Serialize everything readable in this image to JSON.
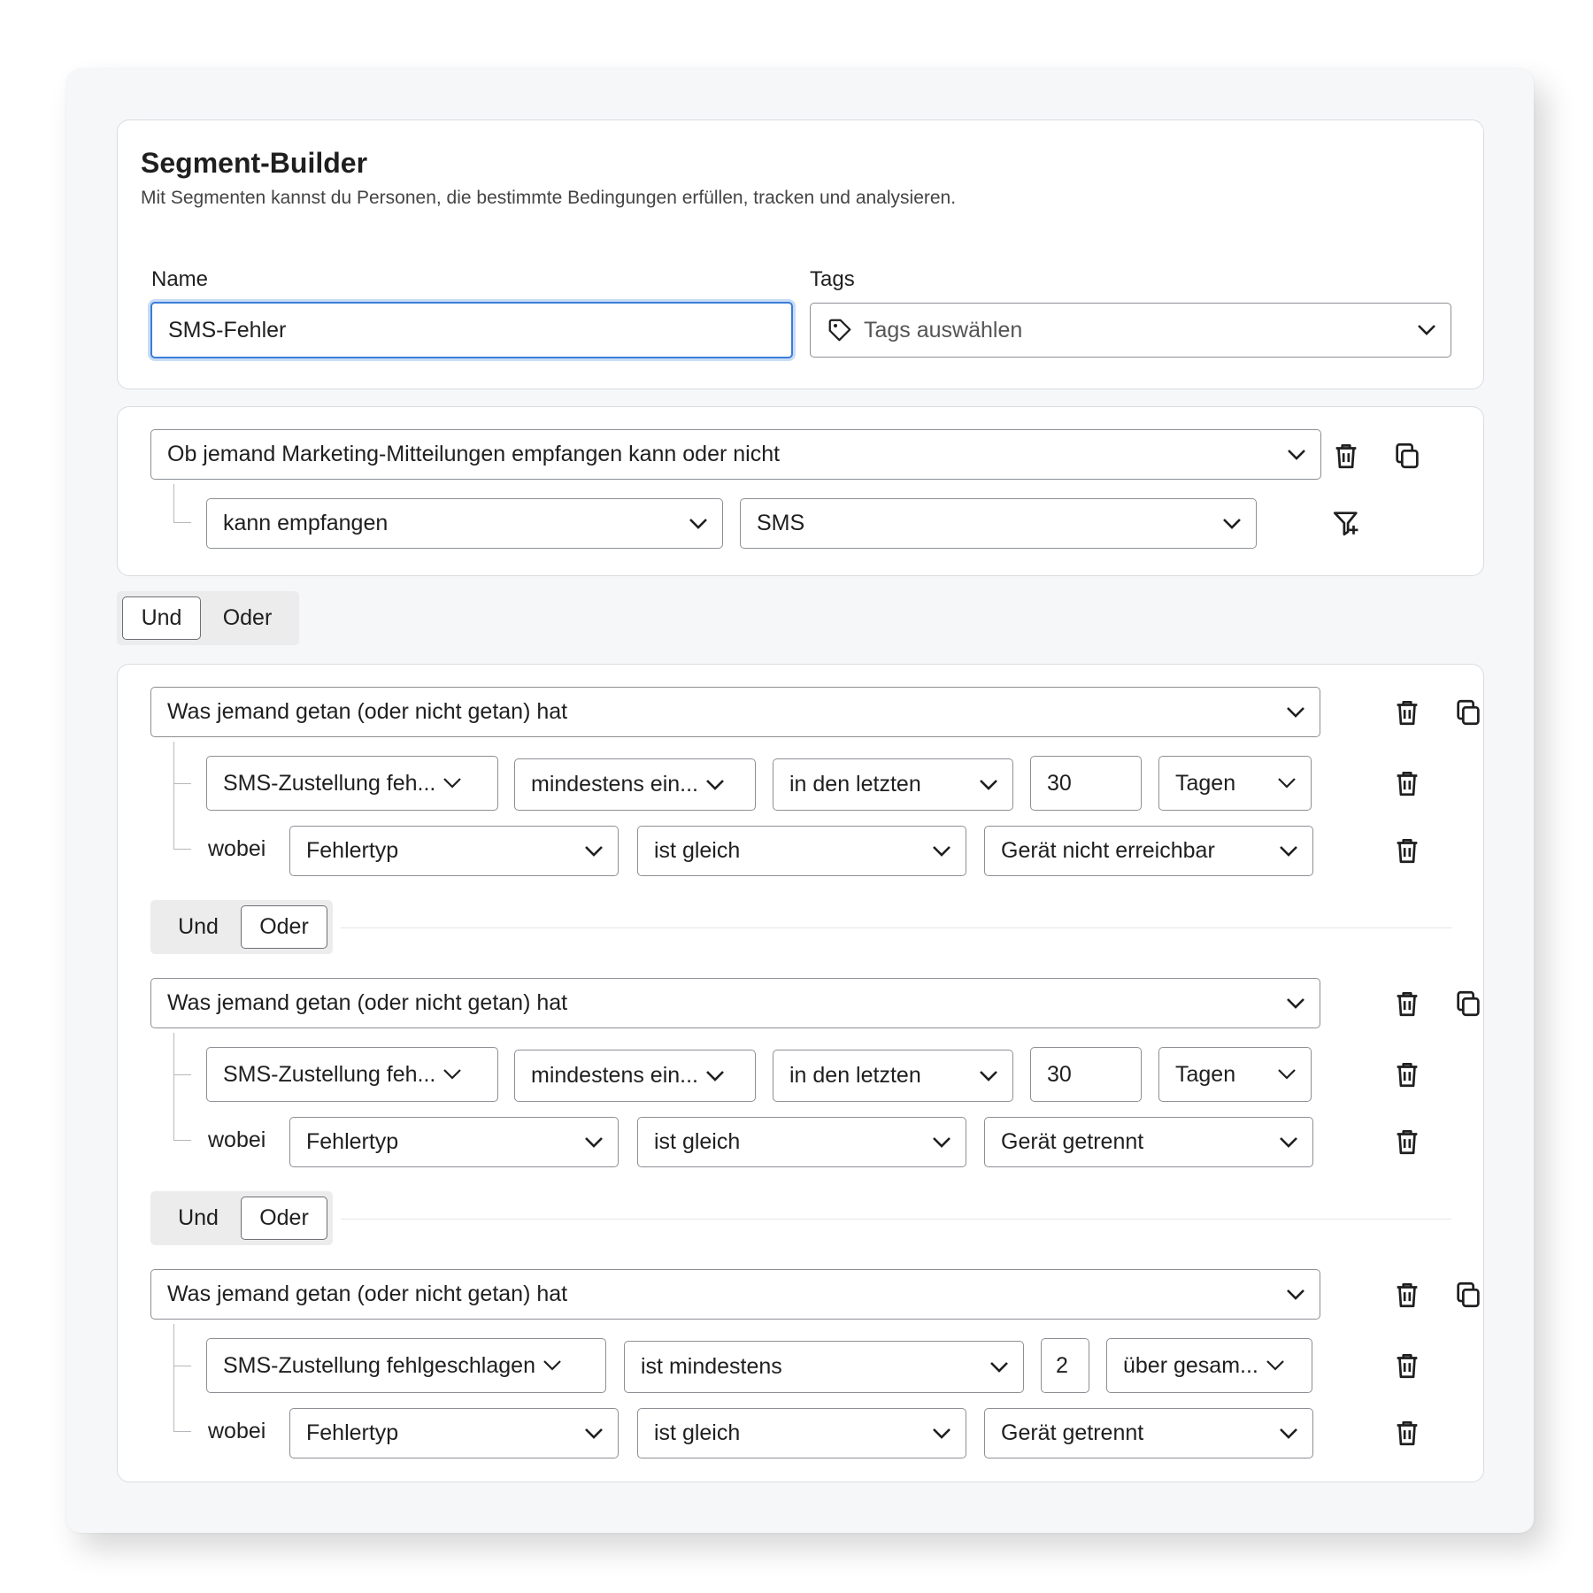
{
  "header": {
    "title": "Segment-Builder",
    "subtitle": "Mit Segmenten kannst du Personen, die bestimmte Bedingungen erfüllen, tracken und analysieren."
  },
  "name_field": {
    "label": "Name",
    "value": "SMS-Fehler"
  },
  "tags_field": {
    "label": "Tags",
    "placeholder": "Tags auswählen"
  },
  "condition1": {
    "type": "Ob jemand Marketing-Mitteilungen empfangen kann oder nicht",
    "status": "kann empfangen",
    "channel": "SMS"
  },
  "group_operator": {
    "options": [
      "Und",
      "Oder"
    ],
    "selected": "Und"
  },
  "group": {
    "operator_options": [
      "Und",
      "Oder"
    ],
    "operator_selected": "Oder",
    "wobei_label": "wobei",
    "rules": [
      {
        "type": "Was jemand getan (oder nicht getan) hat",
        "event": "SMS-Zustellung feh...",
        "frequency": "mindestens ein...",
        "timeframe": "in den letzten",
        "amount": "30",
        "unit": "Tagen",
        "filter_property": "Fehlertyp",
        "filter_operator": "ist gleich",
        "filter_value": "Gerät nicht erreichbar"
      },
      {
        "type": "Was jemand getan (oder nicht getan) hat",
        "event": "SMS-Zustellung feh...",
        "frequency": "mindestens ein...",
        "timeframe": "in den letzten",
        "amount": "30",
        "unit": "Tagen",
        "filter_property": "Fehlertyp",
        "filter_operator": "ist gleich",
        "filter_value": "Gerät getrennt"
      },
      {
        "type": "Was jemand getan (oder nicht getan) hat",
        "event": "SMS-Zustellung fehlgeschlagen",
        "frequency": "ist mindestens",
        "amount": "2",
        "unit": "über gesam...",
        "filter_property": "Fehlertyp",
        "filter_operator": "ist gleich",
        "filter_value": "Gerät getrennt"
      }
    ]
  },
  "icons": {
    "delete": "trash-icon",
    "duplicate": "copy-icon",
    "add_filter": "filter-plus-icon",
    "tag": "tag-icon",
    "dropdown": "chevron-down-icon"
  }
}
